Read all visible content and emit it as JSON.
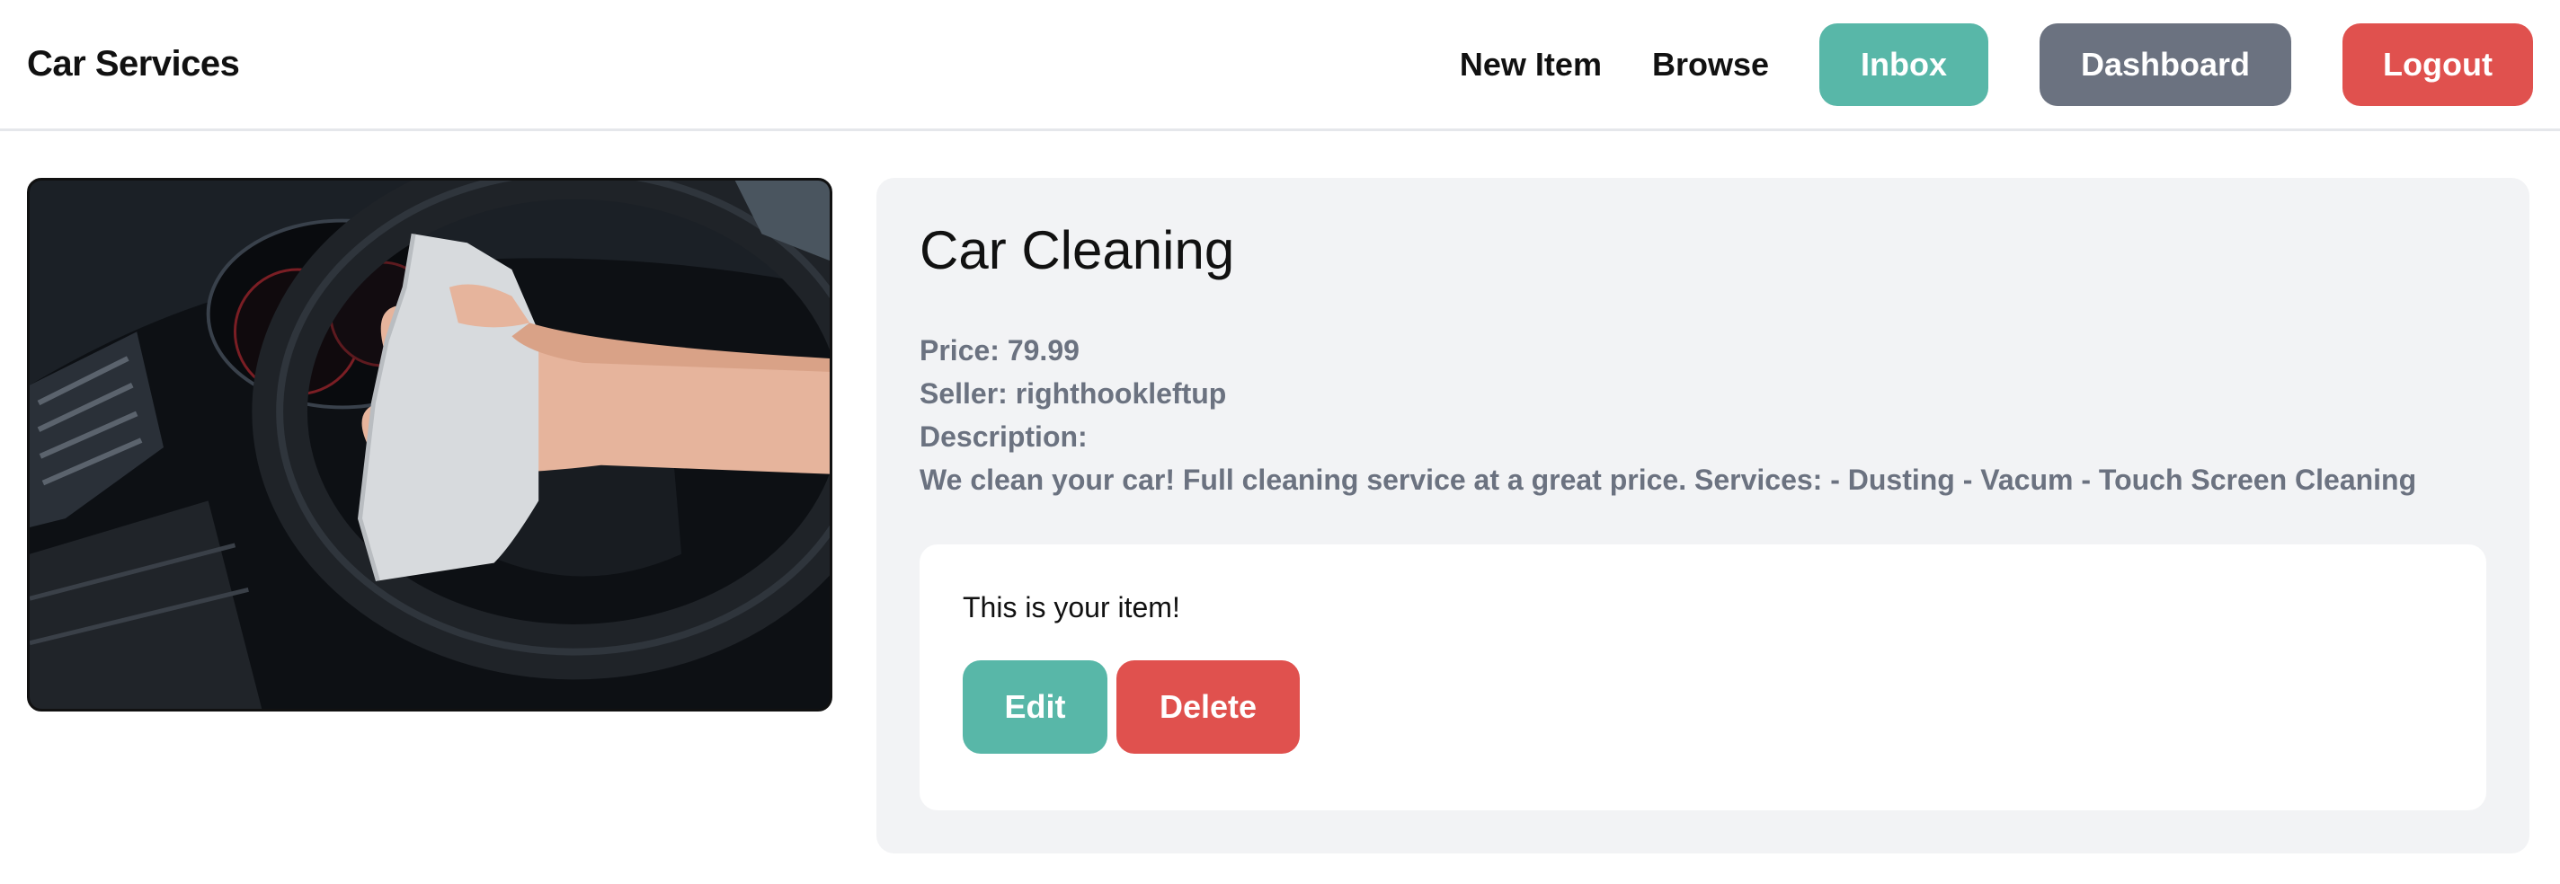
{
  "navbar": {
    "brand": "Car Services",
    "links": {
      "new_item": "New Item",
      "browse": "Browse"
    },
    "buttons": {
      "inbox": "Inbox",
      "dashboard": "Dashboard",
      "logout": "Logout"
    }
  },
  "item": {
    "title": "Car Cleaning",
    "price_text": "Price: 79.99",
    "seller_text": "Seller: righthookleftup",
    "description_label": "Description:",
    "description": "We clean your car! Full cleaning service at a great price. Services: - Dusting - Vacum - Touch Screen Cleaning"
  },
  "owner_panel": {
    "note": "This is your item!",
    "edit_label": "Edit",
    "delete_label": "Delete"
  },
  "colors": {
    "teal": "#58b7a8",
    "gray": "#6b7280",
    "red": "#e0514e",
    "panel_bg": "#f2f3f5"
  }
}
